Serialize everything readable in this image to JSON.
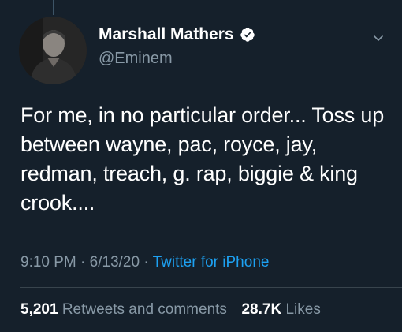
{
  "tweet": {
    "author": {
      "display_name": "Marshall Mathers",
      "handle": "@Eminem",
      "verified_icon": "verified-badge-icon",
      "avatar_icon": "profile-photo"
    },
    "text": "For me, in no particular order... Toss up between wayne, pac, royce, jay, redman, treach, g. rap, biggie & king crook....",
    "time": "9:10 PM",
    "separator": "·",
    "date": "6/13/20",
    "source": "Twitter for iPhone",
    "stats": {
      "retweets_count": "5,201",
      "retweets_label": "Retweets and comments",
      "likes_count": "28.7K",
      "likes_label": "Likes"
    },
    "menu_icon": "chevron-down-icon"
  },
  "colors": {
    "background": "#15202b",
    "secondary_text": "#8899a6",
    "link": "#1da1f2",
    "divider": "#38444d"
  }
}
